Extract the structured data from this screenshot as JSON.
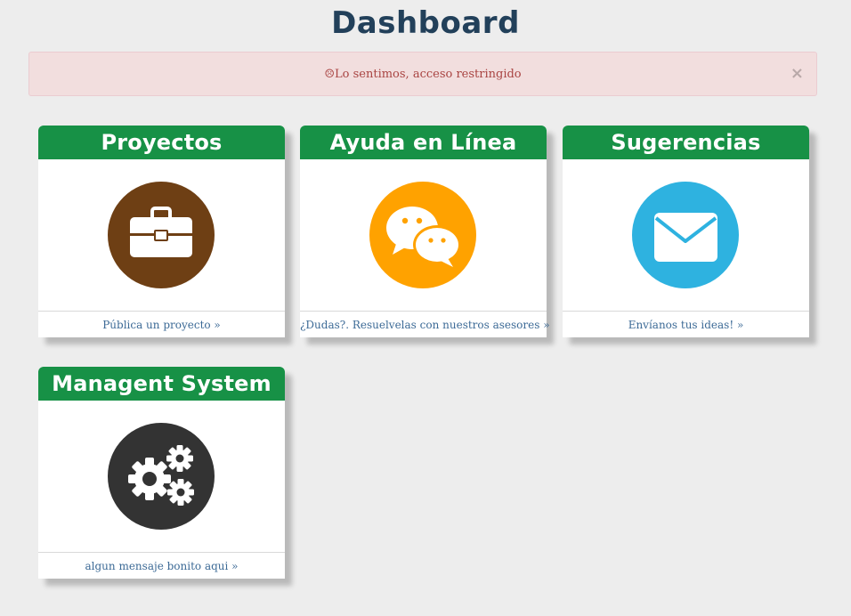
{
  "page": {
    "title": "Dashboard"
  },
  "alert": {
    "icon": "sad-face-icon",
    "icon_glyph": "☹",
    "message": "Lo sentimos, acceso restringido",
    "close_glyph": "×",
    "background": "#f2dede",
    "text_color": "#a94442"
  },
  "colors": {
    "header_green": "#179146",
    "title_color": "#22405a",
    "link_color": "#3c6a96"
  },
  "cards": [
    {
      "title": "Proyectos",
      "icon": "briefcase-icon",
      "icon_color": "#6e3f14",
      "link": "Pública un proyecto »"
    },
    {
      "title": "Ayuda en Línea",
      "icon": "chat-bubbles-icon",
      "icon_color": "#ffa200",
      "link": "¿Dudas?. Resuelvelas con nuestros asesores »"
    },
    {
      "title": "Sugerencias",
      "icon": "envelope-icon",
      "icon_color": "#2eb2e0",
      "link": "Envíanos tus ideas! »"
    },
    {
      "title": "Managent System",
      "icon": "gears-icon",
      "icon_color": "#333333",
      "link": "algun mensaje bonito aqui »"
    }
  ]
}
